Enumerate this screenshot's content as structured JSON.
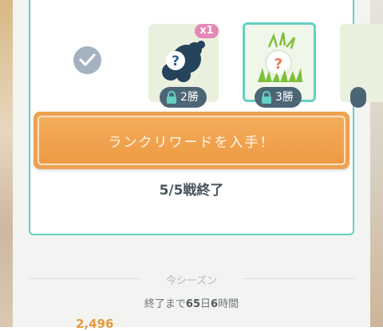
{
  "rewards": {
    "items": [
      {
        "status": "claimed"
      },
      {
        "badge": "x1",
        "requirement": "2勝"
      },
      {
        "requirement": "3勝"
      },
      {
        "requirement": ""
      }
    ]
  },
  "cta": {
    "label": "ランクリワードを入手！"
  },
  "battle": {
    "status": "5/5戦終了"
  },
  "season": {
    "title": "今シーズン",
    "remaining_prefix": "終了まで",
    "days": "65",
    "days_unit": "日",
    "hours": "6",
    "hours_unit": "時間",
    "score": "2,496"
  },
  "colors": {
    "accent_teal": "#64cfc3",
    "cta_orange": "#f0a150",
    "lock_pill": "#4c6575",
    "badge_pink": "#e488b6"
  },
  "icons": [
    "check-icon",
    "mystery-storm-icon",
    "mystery-grass-icon",
    "lock-icon"
  ]
}
